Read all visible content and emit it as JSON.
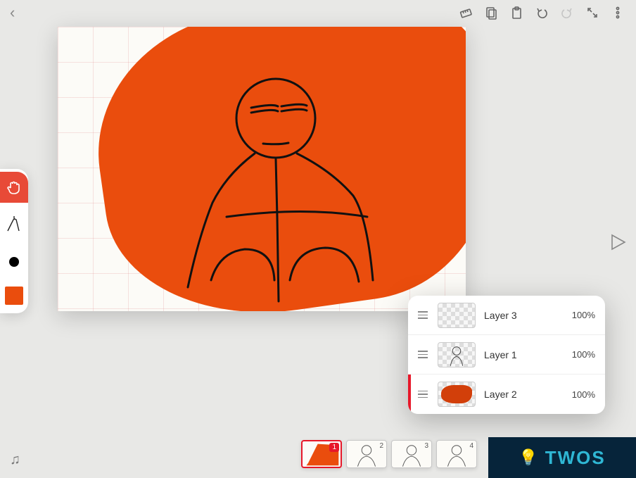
{
  "toolbar": {
    "back": "‹",
    "icons": {
      "ruler": "ruler-icon",
      "copy": "copy-icon",
      "paste": "clipboard-icon",
      "undo": "undo-icon",
      "redo": "redo-icon",
      "fullscreen": "fullscreen-icon",
      "more": "more-icon"
    }
  },
  "tools": {
    "accent_color": "#e84a37",
    "swatch_color": "#ea4d0d"
  },
  "canvas": {
    "grid": true
  },
  "layers": [
    {
      "name": "Layer 3",
      "opacity": "100%",
      "selected": false,
      "art": "empty"
    },
    {
      "name": "Layer 1",
      "opacity": "100%",
      "selected": false,
      "art": "figure"
    },
    {
      "name": "Layer 2",
      "opacity": "100%",
      "selected": true,
      "art": "orange"
    }
  ],
  "frames": [
    {
      "number": "1",
      "selected": true,
      "art": "orange-figure"
    },
    {
      "number": "2",
      "selected": false,
      "art": "figure"
    },
    {
      "number": "3",
      "selected": false,
      "art": "figure"
    },
    {
      "number": "4",
      "selected": false,
      "art": "figure"
    }
  ],
  "audio_label": "♫",
  "watermark": "TWOS"
}
